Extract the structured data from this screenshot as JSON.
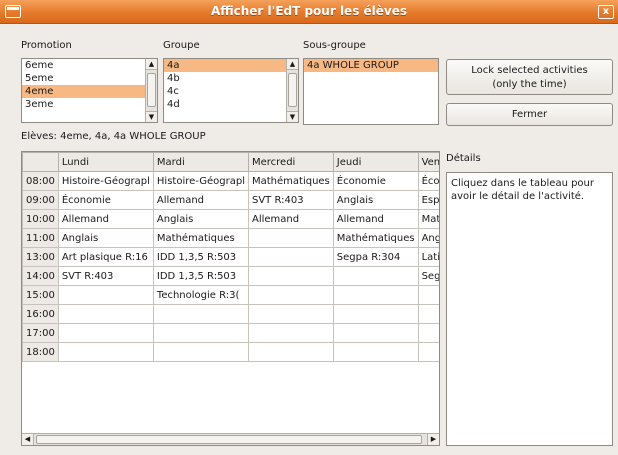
{
  "window": {
    "title": "Afficher l'EdT pour les élèves",
    "close_glyph": "x"
  },
  "promotion": {
    "label": "Promotion",
    "items": [
      "6eme",
      "5eme",
      "4eme",
      "3eme"
    ],
    "selected": 2
  },
  "groupe": {
    "label": "Groupe",
    "items": [
      "4a",
      "4b",
      "4c",
      "4d"
    ],
    "selected": 0
  },
  "sousgroupe": {
    "label": "Sous-groupe",
    "items": [
      "4a WHOLE GROUP"
    ],
    "selected": 0
  },
  "buttons": {
    "lock_line1": "Lock selected activities",
    "lock_line2": "(only the time)",
    "close": "Fermer"
  },
  "eleves": "Elèves: 4eme, 4a, 4a WHOLE GROUP",
  "timetable": {
    "days": [
      "Lundi",
      "Mardi",
      "Mercredi",
      "Jeudi",
      "Vendre"
    ],
    "rows": [
      {
        "time": "08:00",
        "cells": [
          "Histoire-Géograpl",
          "Histoire-Géograpl",
          "Mathématiques",
          "Économie",
          "Écono"
        ]
      },
      {
        "time": "09:00",
        "cells": [
          "Économie",
          "Allemand",
          "SVT R:403",
          "Anglais",
          "Espagn"
        ]
      },
      {
        "time": "10:00",
        "cells": [
          "Allemand",
          "Anglais",
          "Allemand",
          "Allemand",
          "Mathém"
        ]
      },
      {
        "time": "11:00",
        "cells": [
          "Anglais",
          "Mathématiques",
          "",
          "Mathématiques",
          "Anglais"
        ]
      },
      {
        "time": "13:00",
        "cells": [
          "Art plasique R:16",
          "IDD 1,3,5 R:503",
          "",
          "Segpa R:304",
          "Latin R"
        ]
      },
      {
        "time": "14:00",
        "cells": [
          "SVT R:403",
          "IDD 1,3,5 R:503",
          "",
          "",
          "Segpa"
        ]
      },
      {
        "time": "15:00",
        "cells": [
          "",
          "Technologie R:3(",
          "",
          "",
          ""
        ]
      },
      {
        "time": "16:00",
        "cells": [
          "",
          "",
          "",
          "",
          ""
        ]
      },
      {
        "time": "17:00",
        "cells": [
          "",
          "",
          "",
          "",
          ""
        ]
      },
      {
        "time": "18:00",
        "cells": [
          "",
          "",
          "",
          "",
          ""
        ]
      }
    ]
  },
  "details": {
    "label": "Détails",
    "text": "Cliquez dans le tableau pour avoir le détail de l'activité."
  },
  "icons": {
    "scroll_up": "▲",
    "scroll_down": "▼",
    "scroll_left": "◀",
    "scroll_right": "▶"
  }
}
